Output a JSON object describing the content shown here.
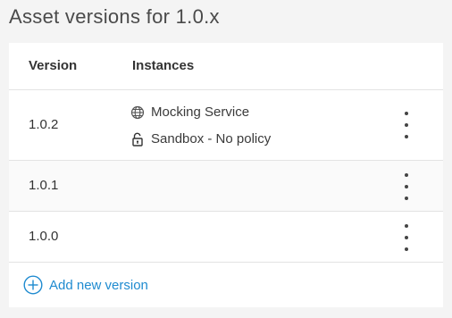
{
  "page": {
    "title": "Asset versions for 1.0.x"
  },
  "table": {
    "columns": {
      "version": "Version",
      "instances": "Instances"
    },
    "rows": [
      {
        "version": "1.0.2",
        "instances": [
          {
            "icon": "globe-icon",
            "label": "Mocking Service"
          },
          {
            "icon": "lock-icon",
            "label": "Sandbox - No policy"
          }
        ]
      },
      {
        "version": "1.0.1",
        "instances": []
      },
      {
        "version": "1.0.0",
        "instances": []
      }
    ]
  },
  "actions": {
    "add_version_label": "Add new version"
  },
  "colors": {
    "accent": "#1f8bd0",
    "background": "#f4f4f4",
    "card": "#ffffff"
  }
}
